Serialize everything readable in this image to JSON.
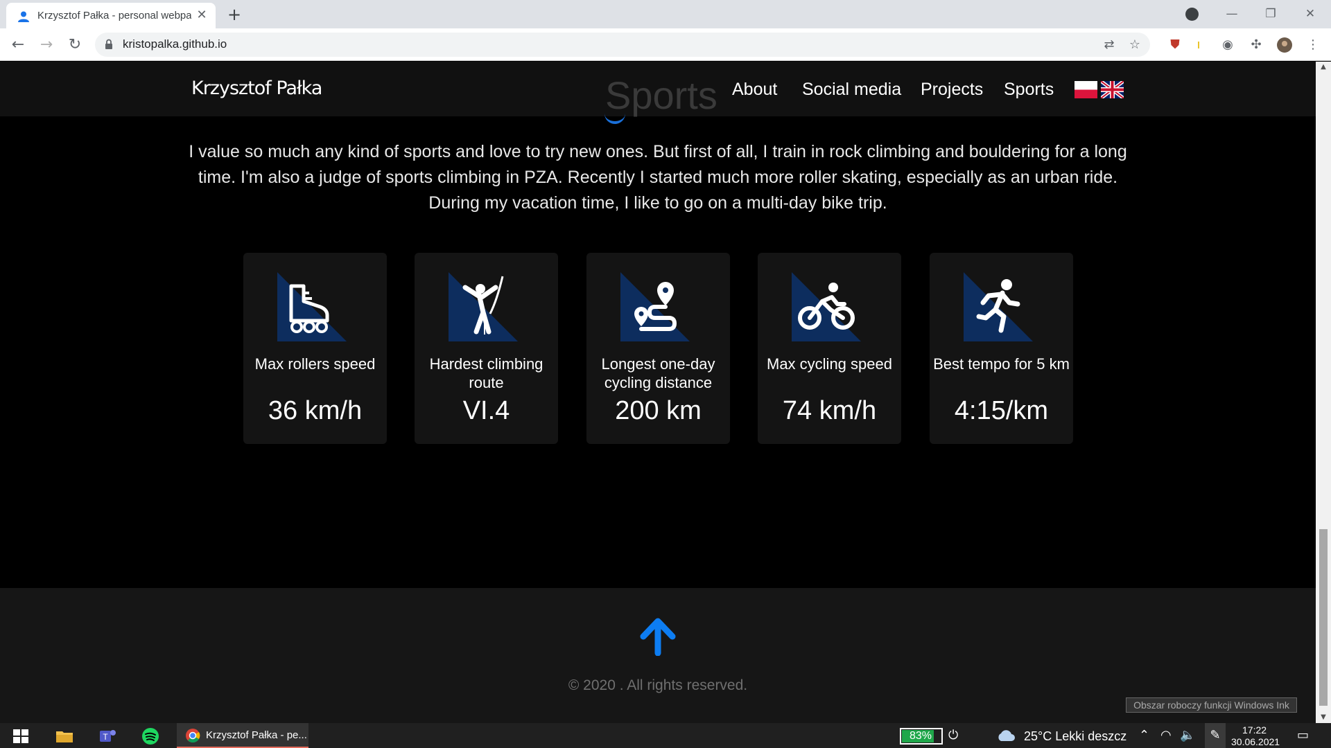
{
  "browser": {
    "tab_title": "Krzysztof Pałka - personal webpa",
    "tab_close": "✕",
    "new_tab": "+",
    "url": "kristopalka.github.io",
    "window_controls": {
      "minimize": "—",
      "restore": "❐",
      "close": "✕"
    }
  },
  "site": {
    "brand": "Krzysztof Pałka",
    "ghost_title": "Sports",
    "nav": [
      "About",
      "Social media",
      "Projects",
      "Sports"
    ],
    "intro": "I value so much any kind of sports and love to try new ones. But first of all, I train in rock climbing and bouldering for a long time. I'm also a judge of sports climbing in PZA. Recently I started much more roller skating, especially as an urban ride. During my vacation time, I like to go on a multi-day bike trip.",
    "cards": [
      {
        "icon": "roller-skate-icon",
        "label": "Max rollers speed",
        "value": "36 km/h"
      },
      {
        "icon": "climber-icon",
        "label": "Hardest climbing route",
        "value": "VI.4"
      },
      {
        "icon": "route-icon",
        "label": "Longest one-day cycling distance",
        "value": "200 km"
      },
      {
        "icon": "cyclist-icon",
        "label": "Max cycling speed",
        "value": "74 km/h"
      },
      {
        "icon": "runner-icon",
        "label": "Best tempo for 5 km",
        "value": "4:15/km"
      }
    ],
    "copyright": "© 2020 . All rights reserved.",
    "colors": {
      "accent": "#0d7df2",
      "icon_bg": "#0d2d5e",
      "card": "#141414"
    }
  },
  "tooltip": "Obszar roboczy funkcji Windows Ink",
  "taskbar": {
    "app_label": "Krzysztof Pałka - pe...",
    "battery": "83%",
    "battery_level": 0.83,
    "weather": "25°C  Lekki deszcz",
    "time": "17:22",
    "date": "30.06.2021"
  }
}
